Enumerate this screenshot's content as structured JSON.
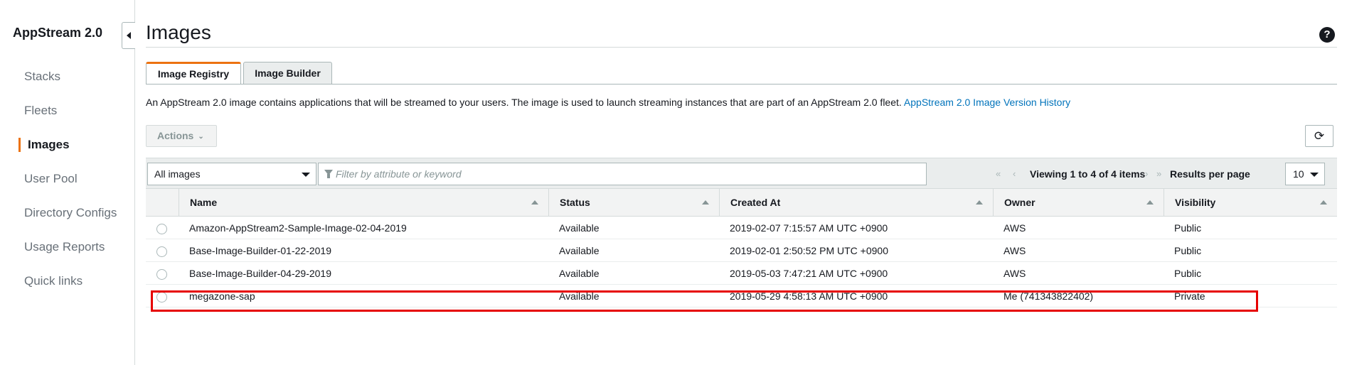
{
  "sidebar": {
    "brand": "AppStream 2.0",
    "items": [
      {
        "label": "Stacks",
        "active": false
      },
      {
        "label": "Fleets",
        "active": false
      },
      {
        "label": "Images",
        "active": true
      },
      {
        "label": "User Pool",
        "active": false
      },
      {
        "label": "Directory Configs",
        "active": false
      },
      {
        "label": "Usage Reports",
        "active": false
      },
      {
        "label": "Quick links",
        "active": false
      }
    ]
  },
  "header": {
    "title": "Images",
    "help_icon": "?"
  },
  "tabs": [
    {
      "label": "Image Registry",
      "active": true
    },
    {
      "label": "Image Builder",
      "active": false
    }
  ],
  "description": {
    "text": "An AppStream 2.0 image contains applications that will be streamed to your users. The image is used to launch streaming instances that are part of an AppStream 2.0 fleet. ",
    "link": "AppStream 2.0 Image Version History"
  },
  "toolbar": {
    "actions_label": "Actions",
    "refresh_icon": "refresh-icon"
  },
  "filter": {
    "select_value": "All images",
    "search_placeholder": "Filter by attribute or keyword",
    "viewing_text": "Viewing 1 to 4 of 4 items",
    "results_per_page_label": "Results per page",
    "results_per_page_value": "10"
  },
  "table": {
    "columns": [
      "Name",
      "Status",
      "Created At",
      "Owner",
      "Visibility"
    ],
    "rows": [
      {
        "name": "Amazon-AppStream2-Sample-Image-02-04-2019",
        "status": "Available",
        "created_at": "2019-02-07 7:15:57 AM UTC +0900",
        "owner": "AWS",
        "visibility": "Public"
      },
      {
        "name": "Base-Image-Builder-01-22-2019",
        "status": "Available",
        "created_at": "2019-02-01 2:50:52 PM UTC +0900",
        "owner": "AWS",
        "visibility": "Public"
      },
      {
        "name": "Base-Image-Builder-04-29-2019",
        "status": "Available",
        "created_at": "2019-05-03 7:47:21 AM UTC +0900",
        "owner": "AWS",
        "visibility": "Public"
      },
      {
        "name": "megazone-sap",
        "status": "Available",
        "created_at": "2019-05-29 4:58:13 AM UTC +0900",
        "owner": "Me (741343822402)",
        "visibility": "Private"
      }
    ]
  },
  "colors": {
    "accent": "#ec7211",
    "link": "#0073bb",
    "highlight_box": "#e60000"
  }
}
